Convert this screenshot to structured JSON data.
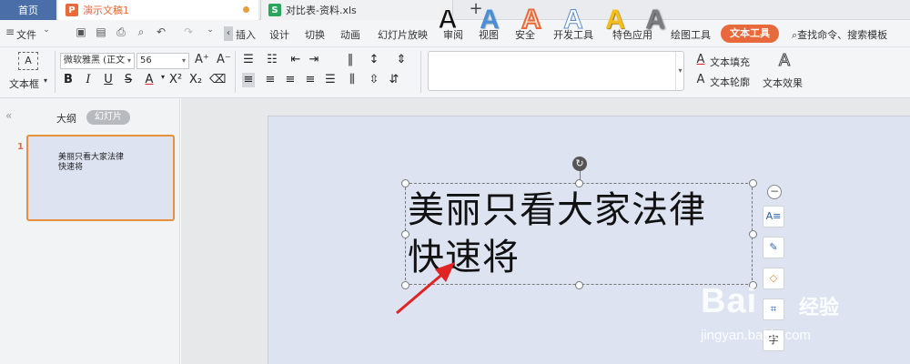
{
  "tabs": {
    "home": "首页",
    "ppt_doc": "演示文稿1",
    "xls_doc": "对比表-资料.xls",
    "add": "+"
  },
  "menu": {
    "file": "文件",
    "items": [
      "插入",
      "设计",
      "切换",
      "动画",
      "幻灯片放映",
      "审阅",
      "视图",
      "安全",
      "开发工具",
      "特色应用",
      "绘图工具"
    ],
    "active": "文本工具",
    "search": "查找命令、搜索模板"
  },
  "ribbon": {
    "textbox": "文本框",
    "font_name": "微软雅黑 (正文",
    "font_size": "56",
    "grow": "A⁺",
    "shrink": "A⁻",
    "text_fill": "文本填充",
    "text_outline": "文本轮廓",
    "text_effect": "文本效果"
  },
  "left_panel": {
    "outline": "大纲",
    "slides": "幻灯片",
    "slide_number": "1",
    "thumb_line1": "美丽只看大家法律",
    "thumb_line2": "快速将"
  },
  "slide": {
    "line1": "美丽只看大家法律",
    "line2": "快速将"
  },
  "watermark": {
    "logo": "Bai",
    "label": "经验",
    "url": "jingyan.baidu.com"
  },
  "colors": {
    "accent": "#e8693c",
    "home_tab": "#4a6ea8",
    "slide_bg": "#dde3f1",
    "arrow": "#e02424"
  }
}
